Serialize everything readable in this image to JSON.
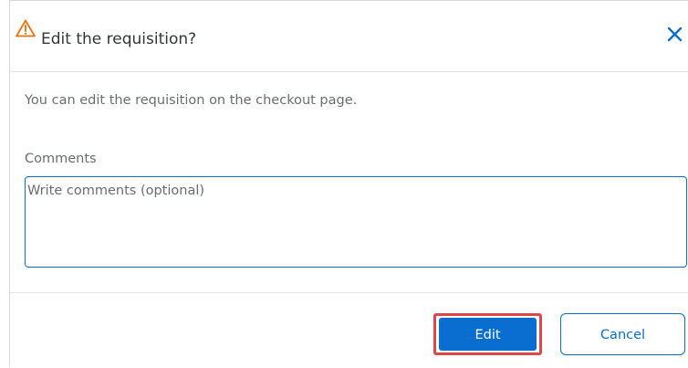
{
  "dialog": {
    "title": "Edit the requisition?",
    "title_icon": "warning-triangle-icon",
    "close_icon": "close-icon",
    "message": "You can edit the requisition on the checkout page.",
    "comments": {
      "label": "Comments",
      "placeholder": "Write comments (optional)",
      "value": ""
    },
    "buttons": {
      "edit_label": "Edit",
      "cancel_label": "Cancel"
    }
  },
  "colors": {
    "accent": "#0a6ed1",
    "warning": "#e9730c",
    "highlight": "#e0474c",
    "text": "#32363a",
    "muted_text": "#6a6d70"
  }
}
